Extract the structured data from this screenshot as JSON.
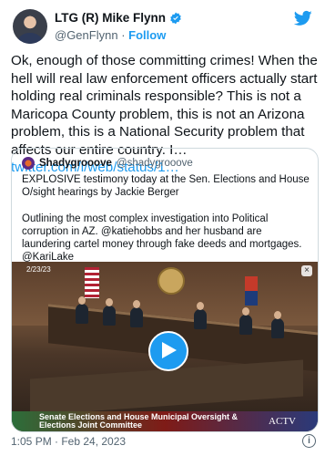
{
  "author": {
    "display_name": "LTG (R) Mike Flynn",
    "handle": "@GenFlynn",
    "separator": "·",
    "follow_label": "Follow"
  },
  "tweet": {
    "text": "Ok, enough of those committing crimes! When the hell will real law enforcement officers actually start holding real criminals responsible? This is not a Maricopa County problem, this is not an Arizona problem, this is a National Security problem that affects our entire country. I…",
    "link": "twitter.com/i/web/status/1…"
  },
  "quoted": {
    "display_name": "Shadygrooove",
    "handle": "@shadygrooove",
    "text": "EXPLOSIVE testimony today at the Sen. Elections and House O/sight hearings by Jackie Berger\n\nOutlining the most complex investigation into Political corruption in AZ. @katiehobbs and her husband are laundering cartel money through fake deeds and mortgages.\n@KariLake"
  },
  "video": {
    "date_stamp": "2/23/23",
    "banner": "Senate Elections and House Municipal Oversight & Elections Joint Committee",
    "channel": "ACTV",
    "close_label": "×"
  },
  "footer": {
    "timestamp": "1:05 PM · Feb 24, 2023",
    "info_label": "i"
  },
  "colors": {
    "accent": "#1d9bf0",
    "text": "#0f1419",
    "muted": "#536471"
  }
}
